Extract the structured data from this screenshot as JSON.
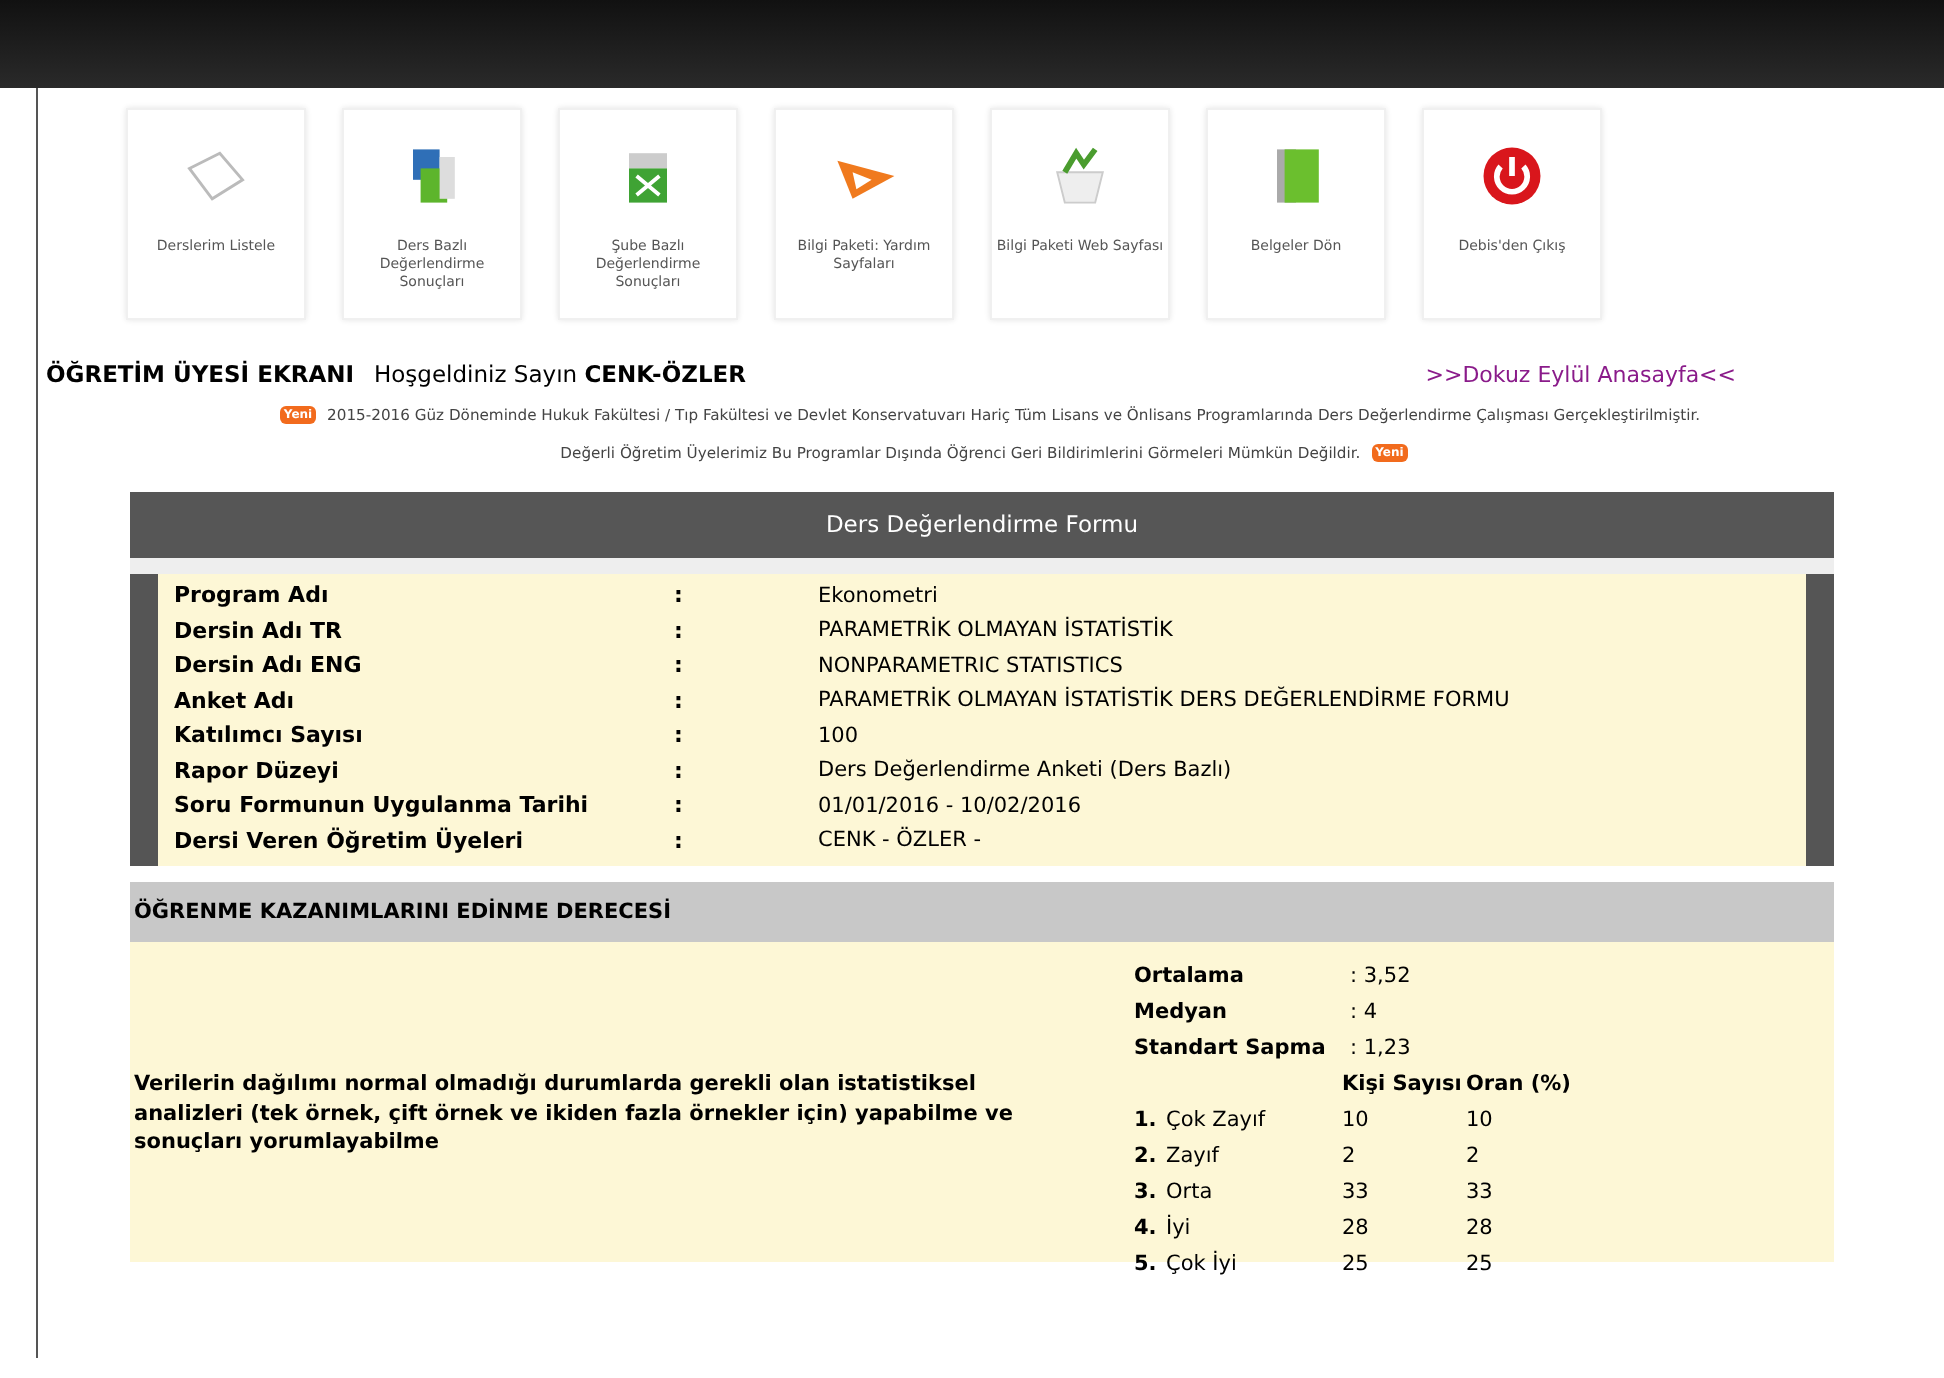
{
  "toolbar": [
    {
      "label": "Derslerim Listele",
      "kind": "paper"
    },
    {
      "label": "Ders Bazlı Değerlendirme Sonuçları",
      "kind": "boxes"
    },
    {
      "label": "Şube Bazlı Değerlendirme Sonuçları",
      "kind": "box"
    },
    {
      "label": "Bilgi Paketi: Yardım Sayfaları",
      "kind": "pencil"
    },
    {
      "label": "Bilgi Paketi Web Sayfası",
      "kind": "basket"
    },
    {
      "label": "Belgeler Dön",
      "kind": "folder"
    },
    {
      "label": "Debis'den Çıkış",
      "kind": "power"
    }
  ],
  "header": {
    "screen_title": "ÖĞRETİM ÜYESİ EKRANI",
    "welcome": "Hoşgeldiniz Sayın **CENK-ÖZLER**",
    "home_link": ">>Dokuz Eylül Anasayfa<<"
  },
  "notices": [
    {
      "badge": "Yeni",
      "text": "2015-2016 Güz Döneminde Hukuk Fakültesi / Tıp Fakültesi ve Devlet Konservatuvarı Hariç Tüm Lisans ve Önlisans Programlarında Ders Değerlendirme Çalışması Gerçekleştirilmiştir."
    },
    {
      "badge": "Yeni",
      "text": "Değerli Öğretim Üyelerimiz Bu Programlar Dışında Öğrenci Geri Bildirimlerini Görmeleri Mümkün Değildir."
    }
  ],
  "form": {
    "title": "Ders Değerlendirme Formu",
    "fields": [
      {
        "label": "Program Adı",
        "separator": ":",
        "value": "Ekonometri"
      },
      {
        "label": "Dersin Adı TR",
        "separator": ":",
        "value": "PARAMETRİK OLMAYAN İSTATİSTİK"
      },
      {
        "label": "Dersin Adı ENG",
        "separator": ":",
        "value": "NONPARAMETRIC STATISTICS"
      },
      {
        "label": "Anket Adı",
        "separator": ":",
        "value": "PARAMETRİK OLMAYAN İSTATİSTİK DERS DEĞERLENDİRME FORMU"
      },
      {
        "label": "Katılımcı Sayısı",
        "separator": ":",
        "value": "100"
      },
      {
        "label": "Rapor Düzeyi",
        "separator": ":",
        "value": "Ders Değerlendirme Anketi (Ders Bazlı)"
      },
      {
        "label": "Soru Formunun Uygulanma Tarihi",
        "separator": ":",
        "value": "01/01/2016 - 10/02/2016"
      },
      {
        "label": "Dersi Veren Öğretim Üyeleri",
        "separator": ":",
        "value": "CENK - ÖZLER -"
      }
    ]
  },
  "section": {
    "title": "ÖĞRENME KAZANIMLARINI EDİNME DERECESİ",
    "outcome": "Verilerin dağılımı normal olmadığı durumlarda gerekli olan istatistiksel analizleri (tek örnek, çift örnek ve ikiden fazla örnekler için) yapabilme ve sonuçları yorumlayabilme",
    "stats": [
      {
        "label": "Ortalama",
        "value": ": 3,52"
      },
      {
        "label": "Medyan",
        "value": ": 4"
      },
      {
        "label": "Standart Sapma",
        "value": ": 1,23"
      }
    ],
    "columns": [
      "Kişi Sayısı",
      "Oran (%)"
    ],
    "rows": [
      {
        "number": "1.",
        "label": "Çok Zayıf",
        "count": "10",
        "ratio": "10"
      },
      {
        "number": "2.",
        "label": "Zayıf",
        "count": "2",
        "ratio": "2"
      },
      {
        "number": "3.",
        "label": "Orta",
        "count": "33",
        "ratio": "33"
      },
      {
        "number": "4.",
        "label": "İyi",
        "count": "28",
        "ratio": "28"
      },
      {
        "number": "5.",
        "label": "Çok İyi",
        "count": "25",
        "ratio": "25"
      }
    ]
  }
}
